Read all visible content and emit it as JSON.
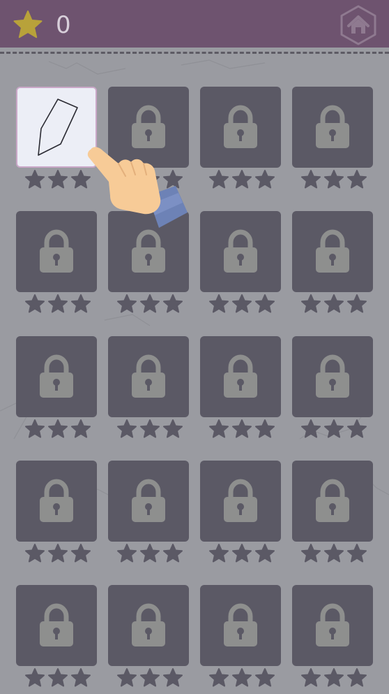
{
  "header": {
    "score": "0",
    "star_icon": "star-icon",
    "home_icon": "home-icon"
  },
  "colors": {
    "header_bg": "#6e536f",
    "background": "#9a9ba1",
    "locked_tile": "#5b5965",
    "lock": "#8e8f8e",
    "unlocked_tile": "#eceef6",
    "star_empty": "#5b5965",
    "star_gold": "#b8a23a"
  },
  "levels": [
    {
      "status": "unlocked",
      "stars_earned": 0
    },
    {
      "status": "locked",
      "stars_earned": 0
    },
    {
      "status": "locked",
      "stars_earned": 0
    },
    {
      "status": "locked",
      "stars_earned": 0
    },
    {
      "status": "locked",
      "stars_earned": 0
    },
    {
      "status": "locked",
      "stars_earned": 0
    },
    {
      "status": "locked",
      "stars_earned": 0
    },
    {
      "status": "locked",
      "stars_earned": 0
    },
    {
      "status": "locked",
      "stars_earned": 0
    },
    {
      "status": "locked",
      "stars_earned": 0
    },
    {
      "status": "locked",
      "stars_earned": 0
    },
    {
      "status": "locked",
      "stars_earned": 0
    },
    {
      "status": "locked",
      "stars_earned": 0
    },
    {
      "status": "locked",
      "stars_earned": 0
    },
    {
      "status": "locked",
      "stars_earned": 0
    },
    {
      "status": "locked",
      "stars_earned": 0
    },
    {
      "status": "locked",
      "stars_earned": 0
    },
    {
      "status": "locked",
      "stars_earned": 0
    },
    {
      "status": "locked",
      "stars_earned": 0
    },
    {
      "status": "locked",
      "stars_earned": 0
    }
  ],
  "tutorial_hint": "pointing-hand-icon"
}
